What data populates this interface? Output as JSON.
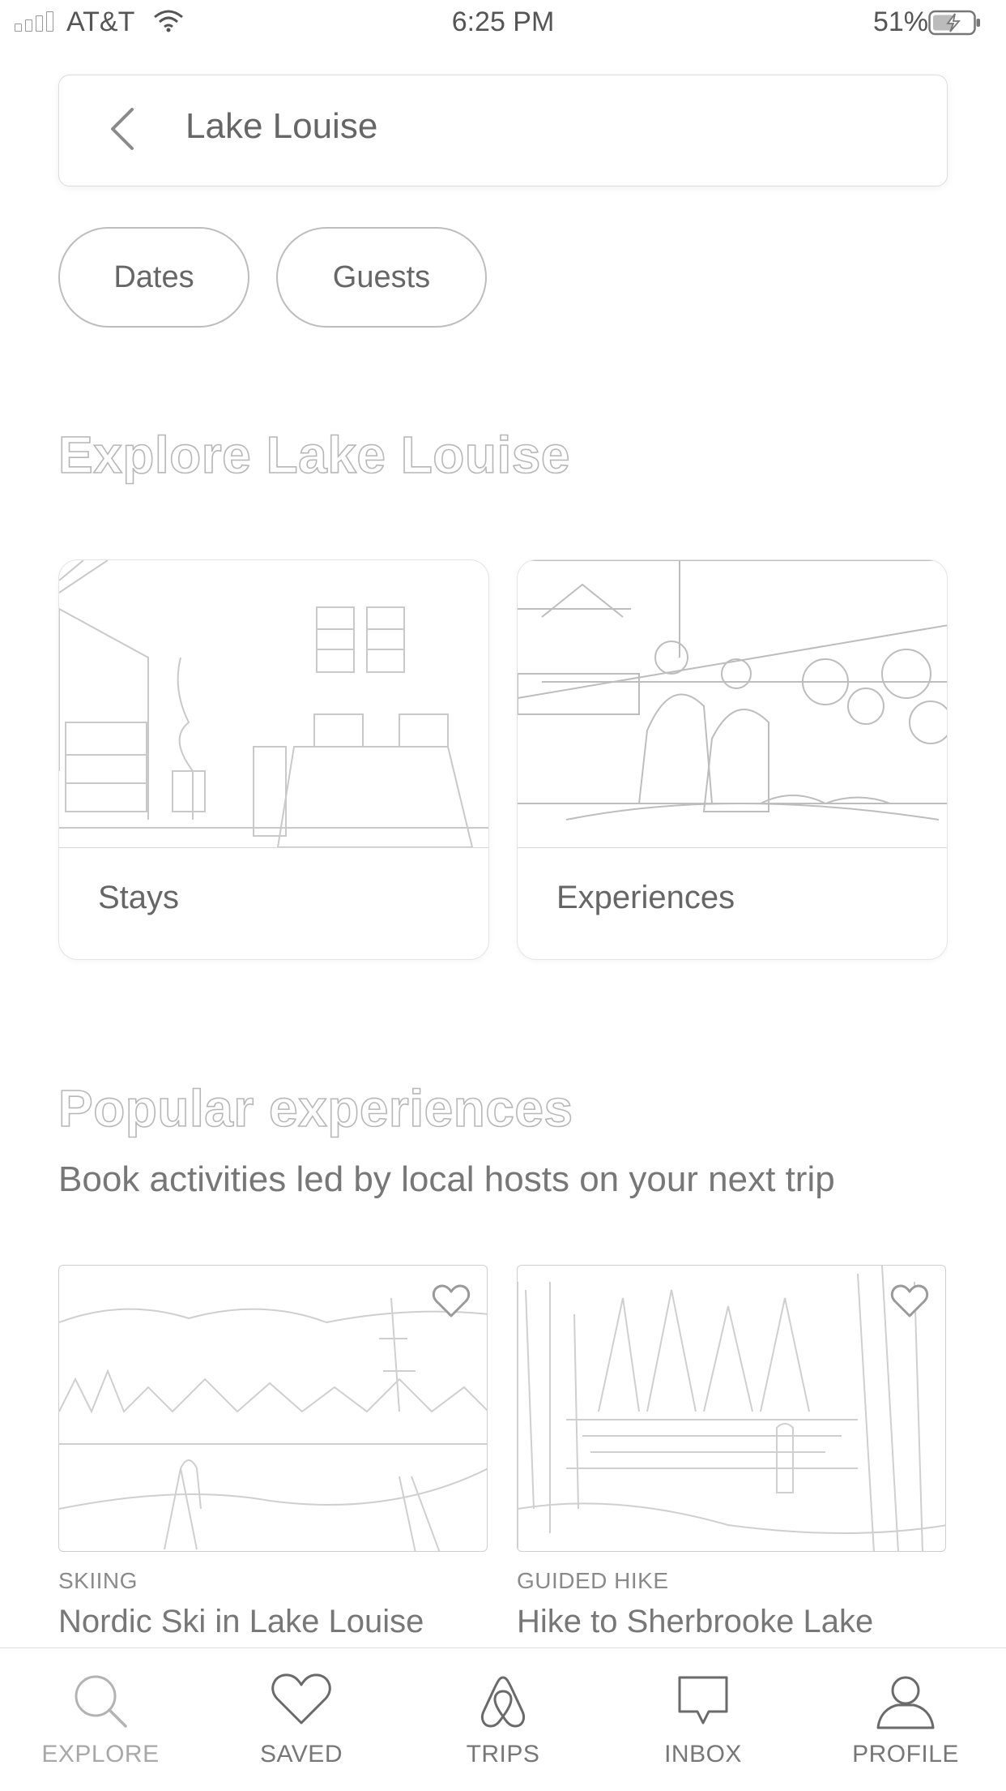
{
  "status_bar": {
    "carrier": "AT&T",
    "time": "6:25 PM",
    "battery": "51%"
  },
  "search": {
    "location": "Lake Louise"
  },
  "filters": {
    "dates": "Dates",
    "guests": "Guests"
  },
  "explore": {
    "heading": "Explore Lake Louise",
    "cards": [
      {
        "label": "Stays"
      },
      {
        "label": "Experiences"
      }
    ]
  },
  "popular": {
    "heading": "Popular experiences",
    "subheading": "Book activities led by local hosts on your next trip",
    "items": [
      {
        "category": "SKIING",
        "title": "Nordic Ski in Lake Louise"
      },
      {
        "category": "GUIDED HIKE",
        "title": "Hike to Sherbrooke Lake"
      }
    ]
  },
  "tabbar": {
    "items": [
      {
        "label": "EXPLORE",
        "icon": "search-icon",
        "active": true
      },
      {
        "label": "SAVED",
        "icon": "heart-icon"
      },
      {
        "label": "TRIPS",
        "icon": "airbnb-logo-icon"
      },
      {
        "label": "INBOX",
        "icon": "message-icon"
      },
      {
        "label": "PROFILE",
        "icon": "profile-icon"
      }
    ]
  }
}
